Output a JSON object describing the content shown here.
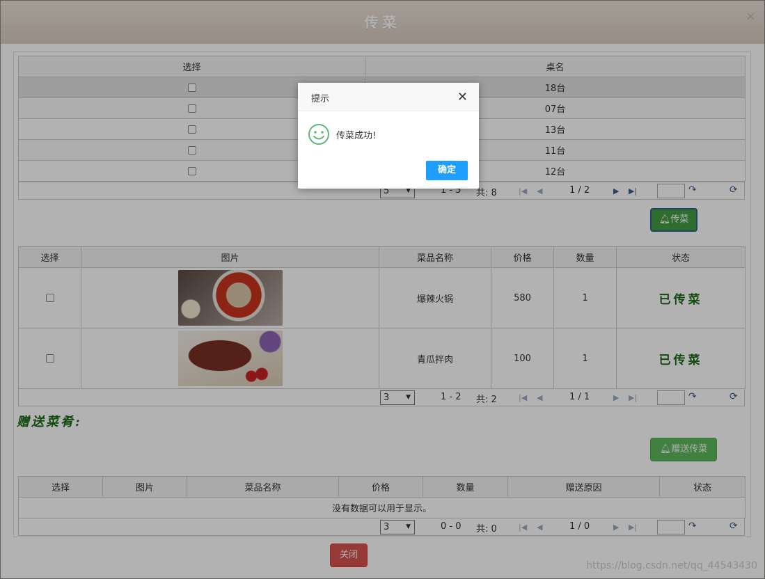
{
  "window": {
    "title": "传菜",
    "close_label": "×"
  },
  "tables_grid": {
    "headers": [
      "选择",
      "桌名"
    ],
    "rows": [
      "18台",
      "07台",
      "13台",
      "11台",
      "12台"
    ],
    "pager": {
      "page_size": "5",
      "range": "1 - 5",
      "total": "共: 8",
      "page": "1 / 2"
    }
  },
  "serve_button_label": "传菜",
  "dishes_grid": {
    "headers": [
      "选择",
      "图片",
      "菜品名称",
      "价格",
      "数量",
      "状态"
    ],
    "rows": [
      {
        "name": "爆辣火锅",
        "price": "580",
        "qty": "1",
        "status": "已传菜",
        "image": "hotpot-photo"
      },
      {
        "name": "青瓜拌肉",
        "price": "100",
        "qty": "1",
        "status": "已传菜",
        "image": "pork-dish-photo"
      }
    ],
    "pager": {
      "page_size": "3",
      "range": "1 - 2",
      "total": "共: 2",
      "page": "1 / 1"
    }
  },
  "gift_section": {
    "title": "赠送菜肴:",
    "button_label": "赠送传菜",
    "headers": [
      "选择",
      "图片",
      "菜品名称",
      "价格",
      "数量",
      "赠送原因",
      "状态"
    ],
    "empty_message": "没有数据可以用于显示。",
    "pager": {
      "page_size": "3",
      "range": "0 - 0",
      "total": "共: 0",
      "page": "1 / 0"
    }
  },
  "close_button_label": "关闭",
  "dialog": {
    "title": "提示",
    "close_label": "✕",
    "message": "传菜成功!",
    "ok_label": "确定",
    "icon": "smile-icon"
  },
  "watermark": "https://blog.csdn.net/qq_44543430",
  "colors": {
    "header": "#d9cdbf",
    "green": "#5cb85c",
    "red": "#d9534f",
    "dialog_ok": "#1e9fff",
    "status_text": "#1b6b1b"
  }
}
